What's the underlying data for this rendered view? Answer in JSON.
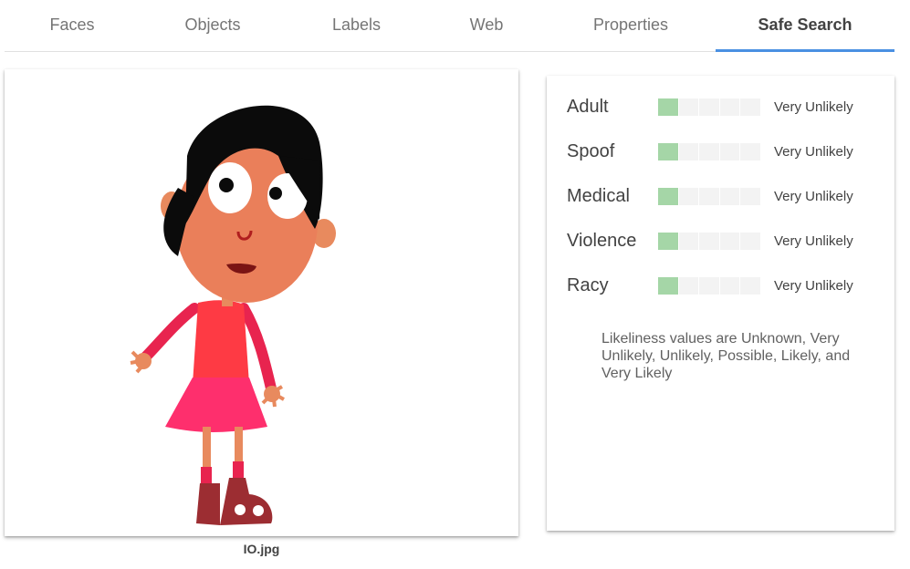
{
  "colors": {
    "accent": "#4a90e2",
    "green": "#a5d6a7"
  },
  "tabs": [
    {
      "label": "Faces",
      "active": false
    },
    {
      "label": "Objects",
      "active": false
    },
    {
      "label": "Labels",
      "active": false
    },
    {
      "label": "Web",
      "active": false
    },
    {
      "label": "Properties",
      "active": false
    },
    {
      "label": "Safe Search",
      "active": true
    }
  ],
  "image": {
    "filename": "IO.jpg"
  },
  "safe_search": {
    "rows": [
      {
        "category": "Adult",
        "level": 1,
        "segments": 5,
        "likelihood": "Very Unlikely"
      },
      {
        "category": "Spoof",
        "level": 1,
        "segments": 5,
        "likelihood": "Very Unlikely"
      },
      {
        "category": "Medical",
        "level": 1,
        "segments": 5,
        "likelihood": "Very Unlikely"
      },
      {
        "category": "Violence",
        "level": 1,
        "segments": 5,
        "likelihood": "Very Unlikely"
      },
      {
        "category": "Racy",
        "level": 1,
        "segments": 5,
        "likelihood": "Very Unlikely"
      }
    ],
    "note": "Likeliness values are Unknown, Very Unlikely, Unlikely, Possible, Likely, and Very Likely"
  }
}
